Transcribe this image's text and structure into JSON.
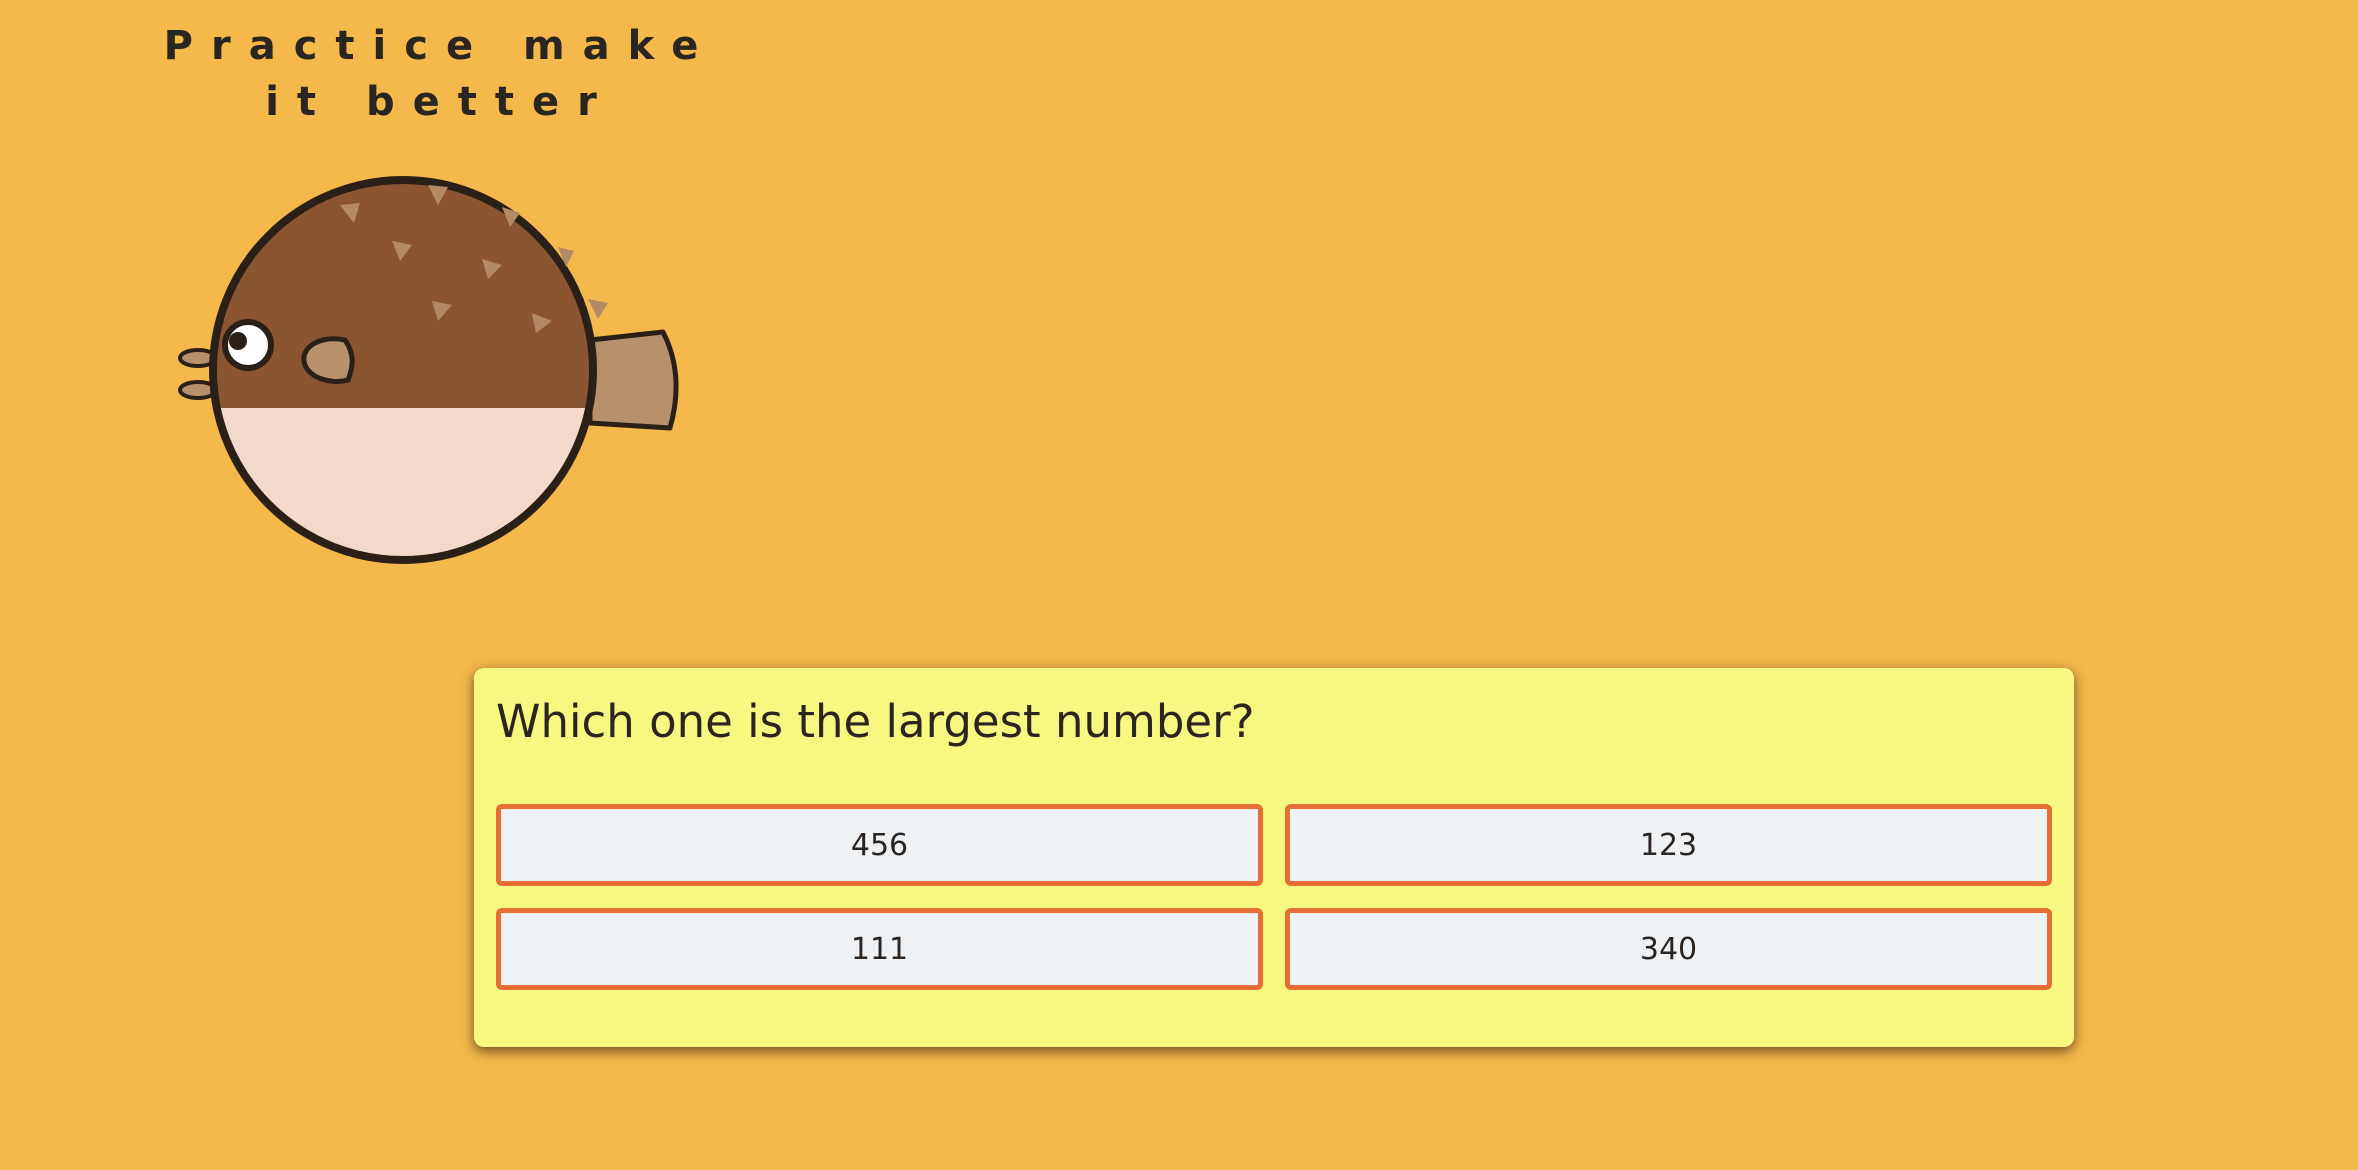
{
  "header": {
    "tagline_line1": "Practice make",
    "tagline_line2": "it better"
  },
  "mascot": {
    "icon": "pufferfish-icon",
    "colors": {
      "body_top": "#8a5530",
      "body_bottom": "#f3d9c9",
      "fin": "#b8916c",
      "outline": "#2b2018"
    }
  },
  "quiz": {
    "question": "Which one is the largest number?",
    "answers": [
      {
        "label": "456"
      },
      {
        "label": "123"
      },
      {
        "label": "111"
      },
      {
        "label": "340"
      }
    ]
  },
  "theme": {
    "background": "#f5b84a",
    "card": "#f6f87f",
    "button_fill": "#eef2f5",
    "button_border": "#e46e34"
  }
}
